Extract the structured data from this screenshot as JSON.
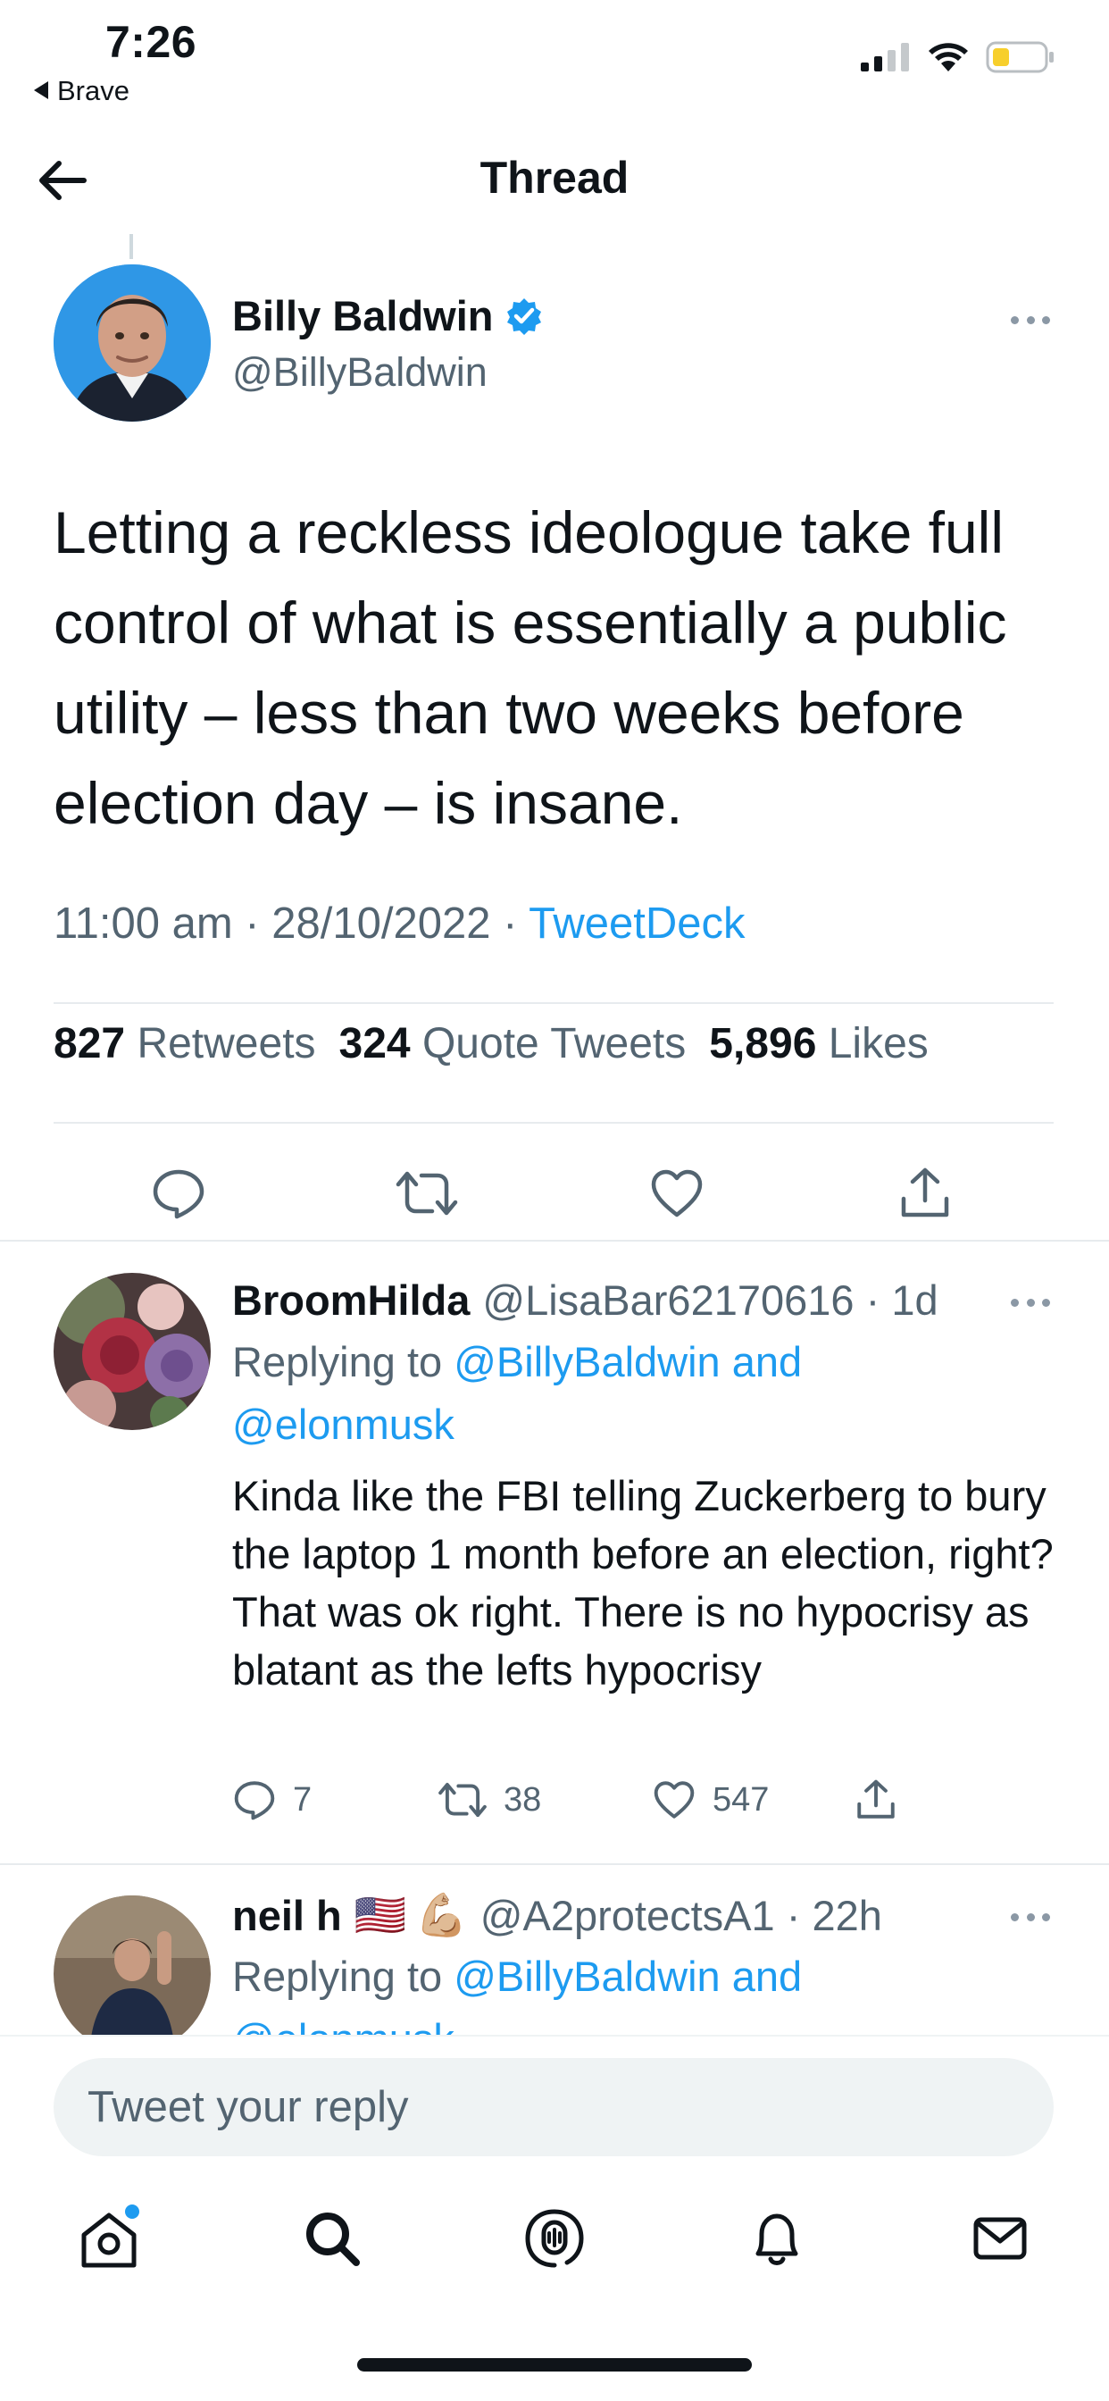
{
  "status": {
    "time": "7:26",
    "back_app": "Brave"
  },
  "header": {
    "title": "Thread"
  },
  "tweet": {
    "author_name": "Billy Baldwin",
    "author_handle": "@BillyBaldwin",
    "verified": true,
    "text": "Letting a reckless ideologue take full control of what is essentially a public utility – less than two weeks before election day – is insane.",
    "time": "11:00 am",
    "date": "28/10/2022",
    "source": "TweetDeck",
    "retweets_count": "827",
    "retweets_label": "Retweets",
    "quotes_count": "324",
    "quotes_label": "Quote Tweets",
    "likes_count": "5,896",
    "likes_label": "Likes"
  },
  "replies": [
    {
      "name": "BroomHilda",
      "handle": "@LisaBar62170616",
      "time": "1d",
      "replying_label": "Replying to",
      "replying_to_1": "@BillyBaldwin and",
      "replying_to_2": "@elonmusk",
      "text": "Kinda like the FBI telling Zuckerberg to bury the laptop 1 month before an election, right?  That was ok right. There is no hypocrisy as blatant as the lefts hypocrisy",
      "replies": "7",
      "retweets": "38",
      "likes": "547"
    },
    {
      "name": "neil h",
      "flag": "🇺🇸",
      "emoji": "💪🏼",
      "handle": "@A2protectsA1",
      "time": "22h",
      "replying_label": "Replying to",
      "replying_to_1": "@BillyBaldwin and",
      "replying_to_2": "@elonmusk"
    }
  ],
  "compose": {
    "placeholder": "Tweet your reply"
  },
  "colors": {
    "accent": "#1d9bf0",
    "text": "#0f1419",
    "secondary": "#536471",
    "divider": "#e7ebee"
  },
  "icons": [
    "back-arrow-icon",
    "verified-badge-icon",
    "more-icon",
    "reply-icon",
    "retweet-icon",
    "like-icon",
    "share-icon",
    "home-icon",
    "search-icon",
    "spaces-icon",
    "notifications-icon",
    "messages-icon"
  ]
}
